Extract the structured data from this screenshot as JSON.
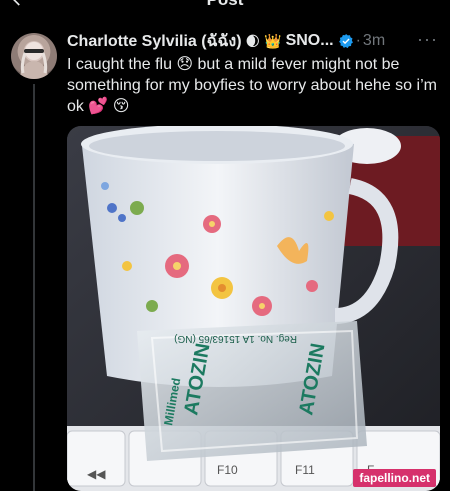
{
  "header": {
    "title": "Post"
  },
  "post": {
    "author_name": "Charlotte Sylvilia (ฉัฉัง)",
    "emoji_moon": "🌒",
    "emoji_crown": "👑",
    "name_tail": "SNO...",
    "separator": "·",
    "time": "3m",
    "more": "···",
    "text": "I caught the flu 😞  but a mild fever might not be something for my boyfies to worry about hehe so i’m ok 💕 😚"
  },
  "media": {
    "packet_text_1": "ATOZIN",
    "packet_text_2": "Millimed",
    "packet_text_3": "ATOZIN",
    "packet_text_4": "Reg. No. 1A 15163/65 (NG)",
    "key_f10": "F10",
    "key_f11": "F11",
    "key_f12": "F",
    "key_arrows": "◀◀"
  },
  "watermark": "fapellino.net",
  "colors": {
    "background": "#000000",
    "text": "#e7e9ea",
    "muted": "#71767b",
    "verified": "#1d9bf0"
  }
}
